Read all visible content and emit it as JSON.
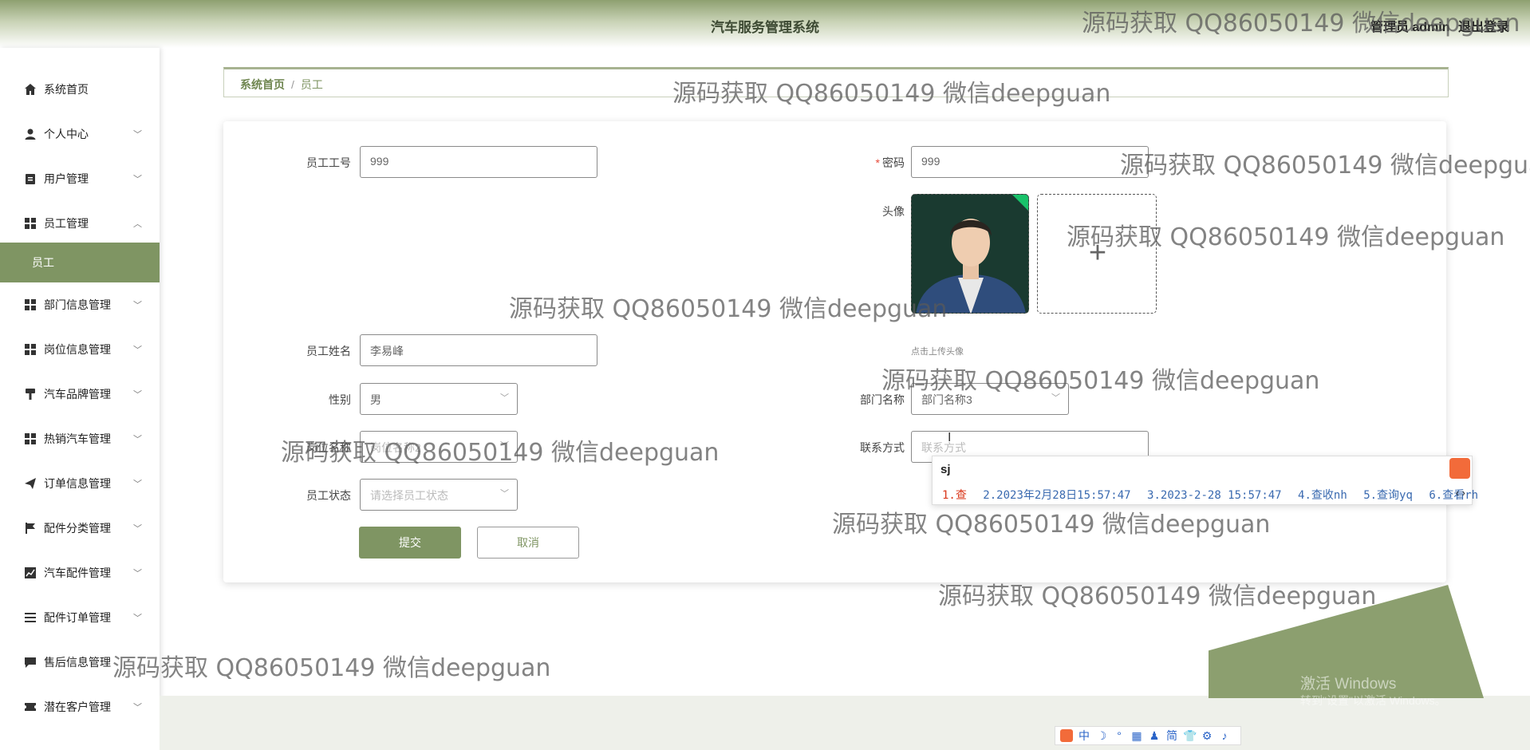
{
  "header": {
    "title": "汽车服务管理系统",
    "user": "管理员 admin",
    "logout": "退出登录"
  },
  "sidebar": {
    "items": [
      {
        "label": "系统首页",
        "icon": "home-icon",
        "chevron": ""
      },
      {
        "label": "个人中心",
        "icon": "user-icon",
        "chevron": "﹀"
      },
      {
        "label": "用户管理",
        "icon": "clipboard-icon",
        "chevron": "﹀"
      },
      {
        "label": "员工管理",
        "icon": "grid-icon",
        "chevron": "︿"
      },
      {
        "label": "员工",
        "icon": "",
        "chevron": ""
      },
      {
        "label": "部门信息管理",
        "icon": "grid-icon",
        "chevron": "﹀"
      },
      {
        "label": "岗位信息管理",
        "icon": "grid-icon",
        "chevron": "﹀"
      },
      {
        "label": "汽车品牌管理",
        "icon": "brush-icon",
        "chevron": "﹀"
      },
      {
        "label": "热销汽车管理",
        "icon": "grid-icon",
        "chevron": "﹀"
      },
      {
        "label": "订单信息管理",
        "icon": "send-icon",
        "chevron": "﹀"
      },
      {
        "label": "配件分类管理",
        "icon": "flag-icon",
        "chevron": "﹀"
      },
      {
        "label": "汽车配件管理",
        "icon": "chart-icon",
        "chevron": "﹀"
      },
      {
        "label": "配件订单管理",
        "icon": "list-icon",
        "chevron": "﹀"
      },
      {
        "label": "售后信息管理",
        "icon": "message-icon",
        "chevron": "﹀"
      },
      {
        "label": "潜在客户管理",
        "icon": "ticket-icon",
        "chevron": "﹀"
      }
    ]
  },
  "breadcrumb": {
    "home": "系统首页",
    "separator": "/",
    "current": "员工"
  },
  "form": {
    "employee_no": {
      "label": "员工工号",
      "value": "999"
    },
    "password": {
      "label": "密码",
      "required_mark": "*",
      "value": "999"
    },
    "avatar": {
      "label": "头像",
      "upload_hint": "点击上传头像",
      "upload_icon": "+"
    },
    "employee_name": {
      "label": "员工姓名",
      "value": "李易峰"
    },
    "gender": {
      "label": "性别",
      "value": "男"
    },
    "department": {
      "label": "部门名称",
      "value": "部门名称3"
    },
    "position": {
      "label": "岗位名称",
      "value": "岗位名称2"
    },
    "contact": {
      "label": "联系方式",
      "placeholder": "联系方式"
    },
    "status": {
      "label": "员工状态",
      "placeholder": "请选择员工状态"
    },
    "submit_label": "提交",
    "cancel_label": "取消"
  },
  "ime": {
    "input": "sj",
    "candidates": [
      "1.查",
      "2.2023年2月28日15:57:47",
      "3.2023-2-28 15:57:47",
      "4.查收nh",
      "5.查询yq",
      "6.查看rh"
    ],
    "nav": "‹ ›"
  },
  "taskbar": {
    "items": [
      "中",
      "☽",
      "°",
      "▦",
      "♟",
      "简",
      "👕",
      "⚙",
      "♪"
    ]
  },
  "system_notice": {
    "activate_title": "激活 Windows",
    "activate_sub": "转到\"设置\"以激活 Windows。"
  },
  "watermark_text": "源码获取 QQ86050149 微信deepguan",
  "colors": {
    "accent": "#7f9563",
    "header_green": "#8ea070",
    "decoration_green": "#8c9f6f"
  }
}
